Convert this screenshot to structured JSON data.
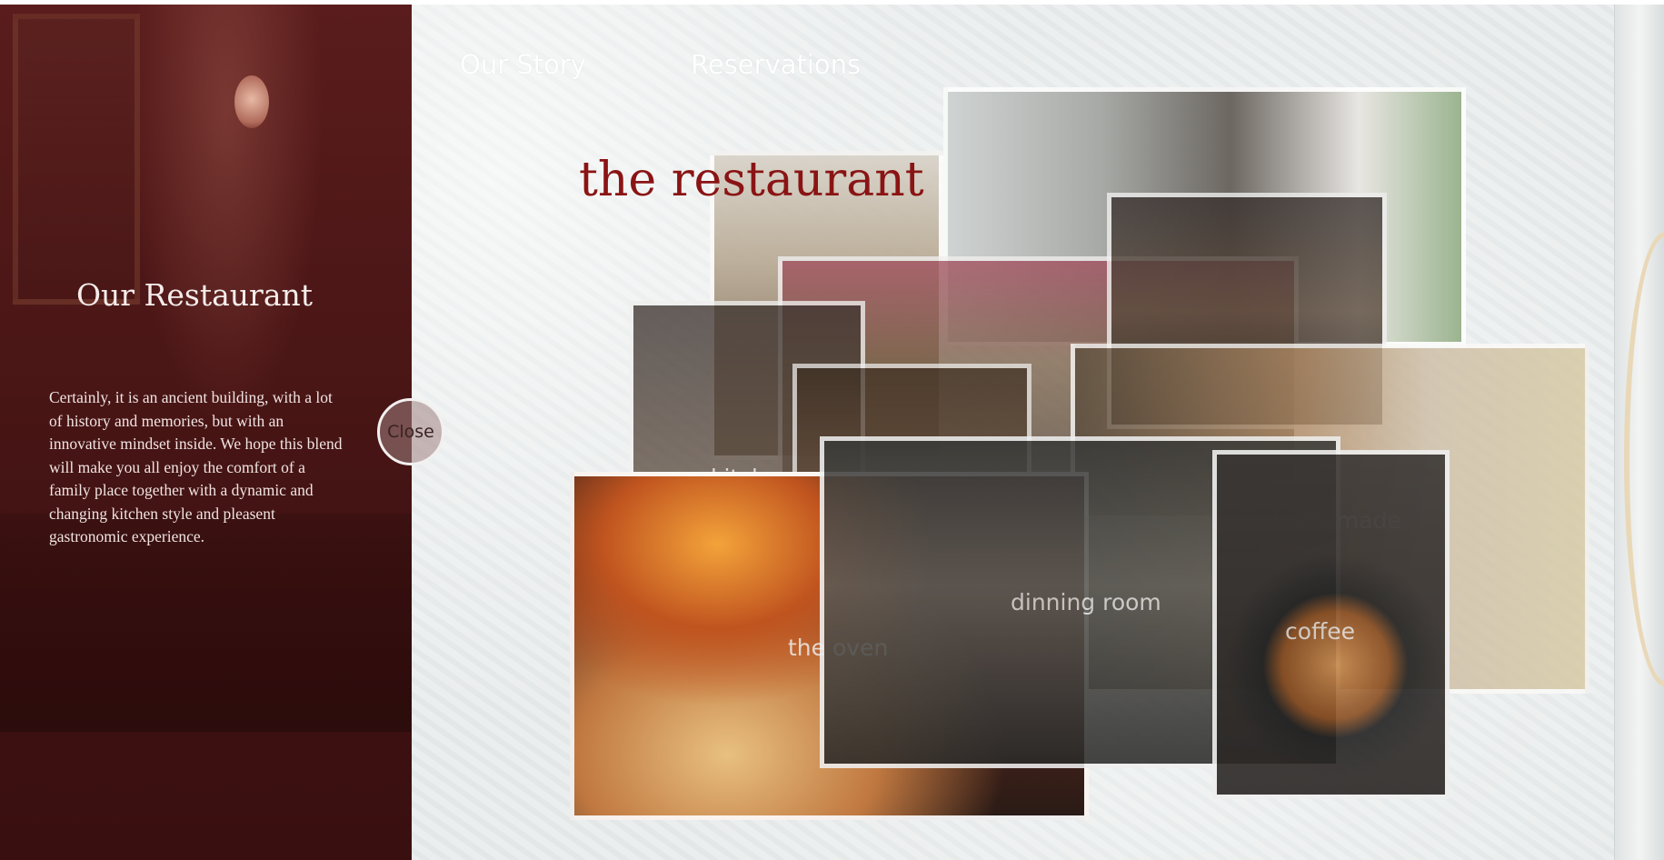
{
  "nav": {
    "story": "Our Story",
    "reservations": "Reservations"
  },
  "page_title": "the restaurant",
  "side_panel": {
    "title": "Our Restaurant",
    "body": "Certainly, it is an ancient building, with a lot of history and memories, but with an innovative mindset inside. We hope this blend will make you all enjoy the comfort of a family place together with a dynamic and changing kitchen style and pleasent gastronomic experience.",
    "close_label": "Close"
  },
  "gallery": {
    "kitchen": "kitchen",
    "oven": "the oven",
    "dining": "dinning room",
    "homemade": "homemade",
    "coffee": "coffee"
  },
  "colors": {
    "panel_bg": "#4b1616",
    "title_accent": "#8a1414"
  }
}
